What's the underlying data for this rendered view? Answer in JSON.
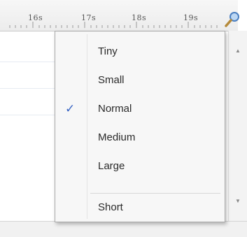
{
  "ruler": {
    "ticks": [
      "16s",
      "17s",
      "18s",
      "19s"
    ]
  },
  "menu": {
    "items": [
      {
        "label": "Tiny",
        "checked": false
      },
      {
        "label": "Small",
        "checked": false
      },
      {
        "label": "Normal",
        "checked": true
      },
      {
        "label": "Medium",
        "checked": false
      },
      {
        "label": "Large",
        "checked": false
      },
      {
        "label": "Short",
        "checked": false
      }
    ],
    "check_mark": "✓"
  },
  "icons": {
    "zoom": "magnifier-icon"
  },
  "colors": {
    "check": "#3a66c4",
    "menu_bg": "#f7f7f7",
    "ruler_bg": "#ececec"
  }
}
